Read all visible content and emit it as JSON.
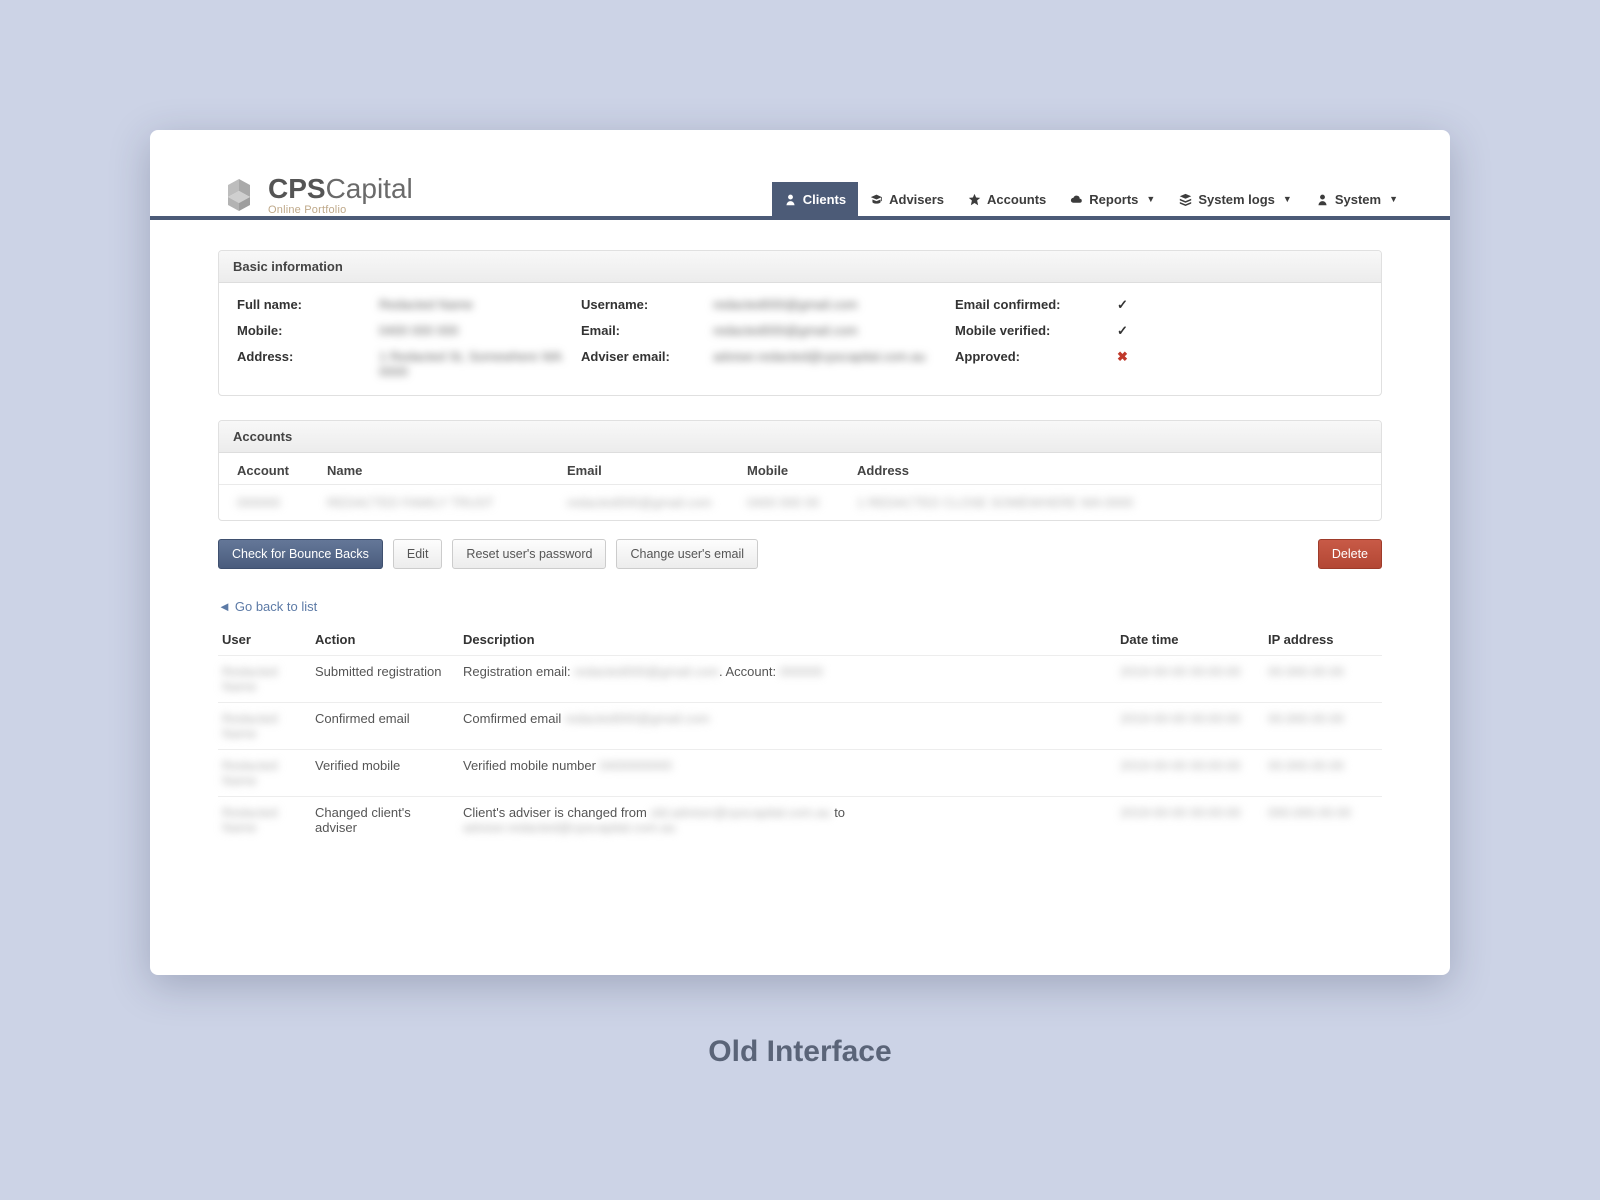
{
  "brand": {
    "bold": "CPS",
    "light": "Capital",
    "subtitle": "Online Portfolio"
  },
  "nav": {
    "clients": {
      "label": "Clients"
    },
    "advisers": {
      "label": "Advisers"
    },
    "accounts": {
      "label": "Accounts"
    },
    "reports": {
      "label": "Reports"
    },
    "systemlogs": {
      "label": "System logs"
    },
    "system": {
      "label": "System"
    }
  },
  "sections": {
    "basic_info": "Basic information",
    "accounts": "Accounts"
  },
  "info": {
    "labels": {
      "full_name": "Full name:",
      "mobile": "Mobile:",
      "address": "Address:",
      "username": "Username:",
      "email": "Email:",
      "adviser_email": "Adviser email:",
      "email_confirmed": "Email confirmed:",
      "mobile_verified": "Mobile verified:",
      "approved": "Approved:"
    },
    "values": {
      "full_name": "Redacted Name",
      "mobile": "0400 000 000",
      "address": "1 Redacted St, Somewhere WA 0000",
      "username": "redacted000@gmail.com",
      "email": "redacted000@gmail.com",
      "adviser_email": "adviser.redacted@cpscapital.com.au"
    },
    "status": {
      "email_confirmed": true,
      "mobile_verified": true,
      "approved": false
    }
  },
  "accounts_table": {
    "headers": {
      "account": "Account",
      "name": "Name",
      "email": "Email",
      "mobile": "Mobile",
      "address": "Address"
    },
    "rows": [
      {
        "account": "000000",
        "name": "REDACTED FAMILY TRUST",
        "email": "redacted000@gmail.com",
        "mobile": "0400 000 00",
        "address": "1 REDACTED CLOSE SOMEWHERE WA 0000"
      }
    ]
  },
  "buttons": {
    "bounce": "Check for Bounce Backs",
    "edit": "Edit",
    "reset_pw": "Reset user's password",
    "change_email": "Change user's email",
    "delete": "Delete"
  },
  "go_back": "Go back to list",
  "log": {
    "headers": {
      "user": "User",
      "action": "Action",
      "description": "Description",
      "datetime": "Date time",
      "ip": "IP address"
    },
    "rows": [
      {
        "user": "Redacted Name",
        "action": "Submitted registration",
        "desc_prefix": "Registration email: ",
        "desc_blur1": "redacted000@gmail.com",
        "desc_mid": ". Account: ",
        "desc_blur2": "000000",
        "datetime": "2019-00-00 00:00:00",
        "ip": "00.000.00.00"
      },
      {
        "user": "Redacted Name",
        "action": "Confirmed email",
        "desc_prefix": "Comfirmed email ",
        "desc_blur1": "redacted000@gmail.com",
        "desc_mid": "",
        "desc_blur2": "",
        "datetime": "2019-00-00 00:00:00",
        "ip": "00.000.00.00"
      },
      {
        "user": "Redacted Name",
        "action": "Verified mobile",
        "desc_prefix": "Verified mobile number ",
        "desc_blur1": "0400000000",
        "desc_mid": "",
        "desc_blur2": "",
        "datetime": "2019-00-00 00:00:00",
        "ip": "00.000.00.00"
      },
      {
        "user": "Redacted Name",
        "action": "Changed client's adviser",
        "desc_prefix": "Client's adviser is changed from ",
        "desc_blur1": "old.adviser@cpscapital.com.au",
        "desc_mid": " to ",
        "desc_blur2": "adviser.redacted@cpscapital.com.au",
        "datetime": "2019-00-00 00:00:00",
        "ip": "000.000.00.00"
      }
    ]
  },
  "caption": "Old Interface"
}
